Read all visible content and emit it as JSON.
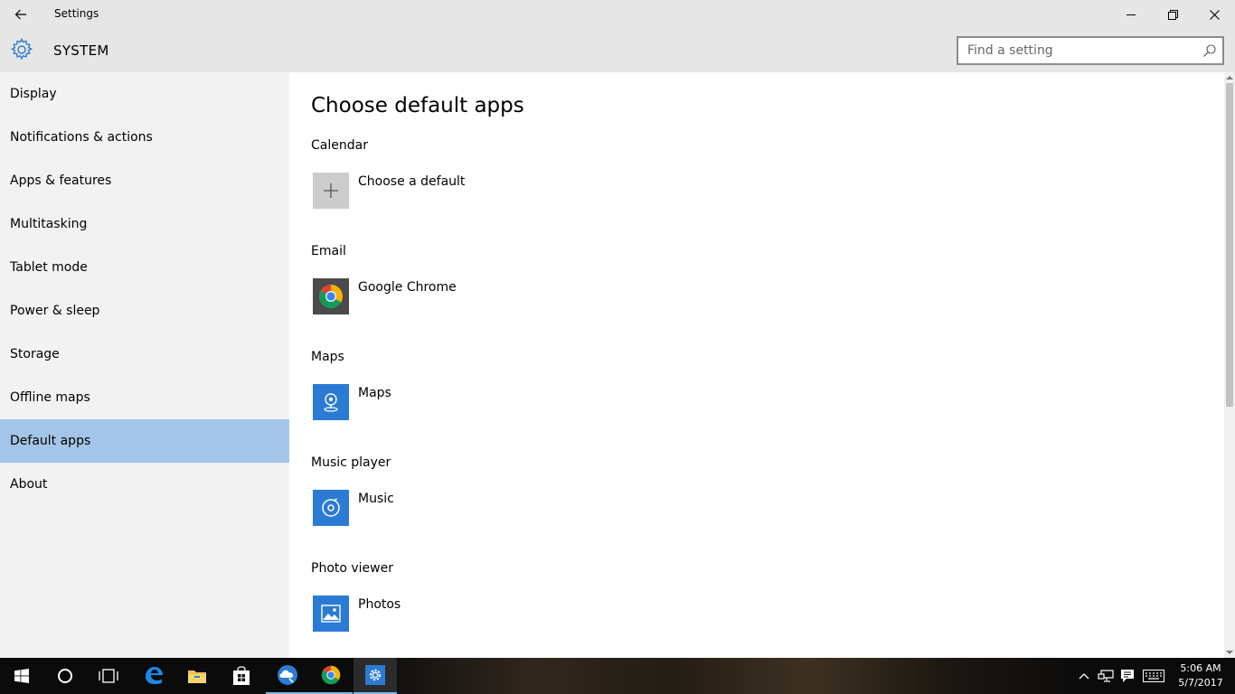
{
  "window": {
    "title": "Settings"
  },
  "header": {
    "section_title": "SYSTEM",
    "search_placeholder": "Find a setting"
  },
  "sidebar": {
    "items": [
      {
        "label": "Display"
      },
      {
        "label": "Notifications & actions"
      },
      {
        "label": "Apps & features"
      },
      {
        "label": "Multitasking"
      },
      {
        "label": "Tablet mode"
      },
      {
        "label": "Power & sleep"
      },
      {
        "label": "Storage"
      },
      {
        "label": "Offline maps"
      },
      {
        "label": "Default apps"
      },
      {
        "label": "About"
      }
    ],
    "selected": "Default apps"
  },
  "main": {
    "title": "Choose default apps",
    "groups": [
      {
        "label": "Calendar",
        "app": "Choose a default",
        "icon": "plus-icon"
      },
      {
        "label": "Email",
        "app": "Google Chrome",
        "icon": "chrome-icon"
      },
      {
        "label": "Maps",
        "app": "Maps",
        "icon": "maps-icon"
      },
      {
        "label": "Music player",
        "app": "Music",
        "icon": "music-icon"
      },
      {
        "label": "Photo viewer",
        "app": "Photos",
        "icon": "photos-icon"
      }
    ]
  },
  "taskbar": {
    "time": "5:06 AM",
    "date": "5/7/2017"
  },
  "colors": {
    "accent": "#2b7bd4",
    "selected_nav": "#a4c5e8",
    "chrome_bg": "#e6e6e6",
    "sidebar_bg": "#f2f2f2"
  }
}
